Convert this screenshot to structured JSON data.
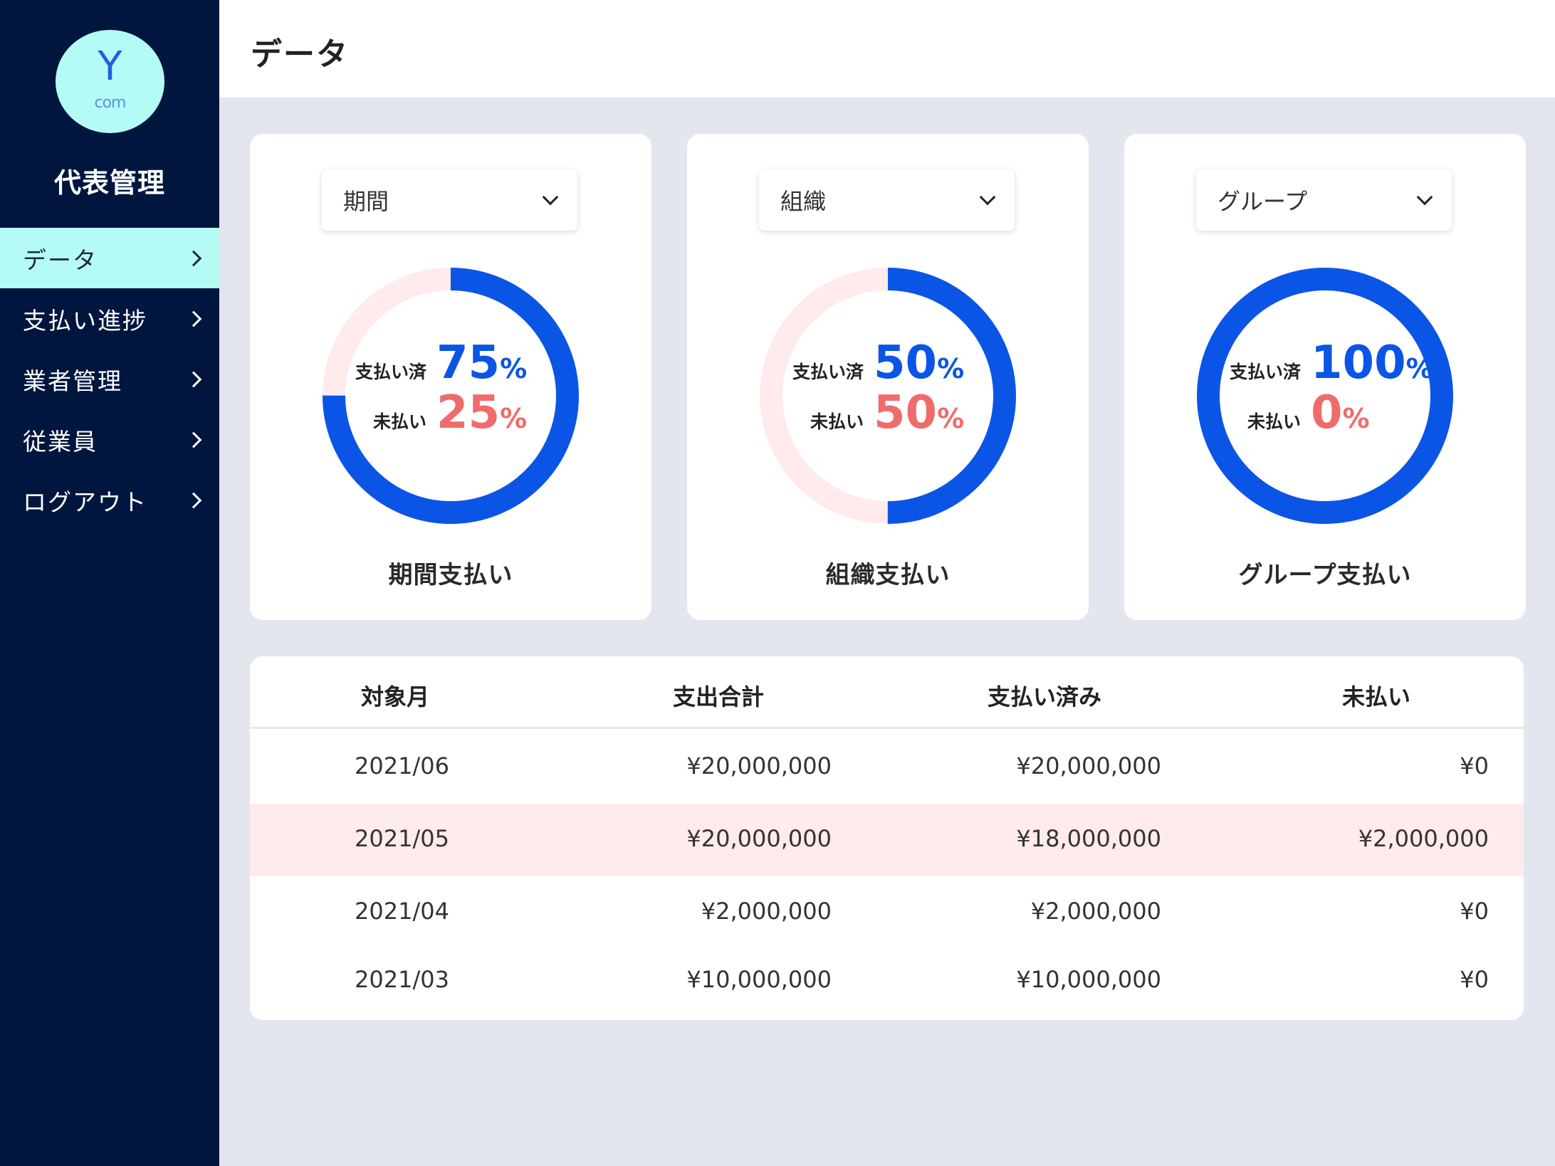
{
  "sidebar": {
    "logo_letter": "Y",
    "logo_sub": "com",
    "brand": "代表管理",
    "items": [
      {
        "label": "データ"
      },
      {
        "label": "支払い進捗"
      },
      {
        "label": "業者管理"
      },
      {
        "label": "従業員"
      },
      {
        "label": "ログアウト"
      }
    ]
  },
  "header": {
    "title": "データ"
  },
  "cards": [
    {
      "dropdown": "期間",
      "paid_label": "支払い済",
      "paid_pct": 75,
      "unpaid_label": "未払い",
      "unpaid_pct": 25,
      "pct_sign": "%",
      "caption": "期間支払い"
    },
    {
      "dropdown": "組織",
      "paid_label": "支払い済",
      "paid_pct": 50,
      "unpaid_label": "未払い",
      "unpaid_pct": 50,
      "pct_sign": "%",
      "caption": "組織支払い"
    },
    {
      "dropdown": "グループ",
      "paid_label": "支払い済",
      "paid_pct": 100,
      "unpaid_label": "未払い",
      "unpaid_pct": 0,
      "pct_sign": "%",
      "caption": "グループ支払い"
    }
  ],
  "table": {
    "headers": [
      "対象月",
      "支出合計",
      "支払い済み",
      "未払い"
    ],
    "rows": [
      [
        "2021/06",
        "¥20,000,000",
        "¥20,000,000",
        "¥0"
      ],
      [
        "2021/05",
        "¥20,000,000",
        "¥18,000,000",
        "¥2,000,000"
      ],
      [
        "2021/04",
        "¥2,000,000",
        "¥2,000,000",
        "¥0"
      ],
      [
        "2021/03",
        "¥10,000,000",
        "¥10,000,000",
        "¥0"
      ]
    ],
    "highlighted_row": 1
  },
  "colors": {
    "sidebar_bg": "#01163f",
    "accent_cyan": "#b4fbf5",
    "paid_blue": "#0b55e6",
    "unpaid_red": "#f06c6c",
    "unpaid_ring": "#ffeaec",
    "highlight_row": "#ffeaec"
  },
  "icons": {
    "nav_arrow": "chevron-right-icon",
    "dropdown_arrow": "chevron-down-icon"
  }
}
